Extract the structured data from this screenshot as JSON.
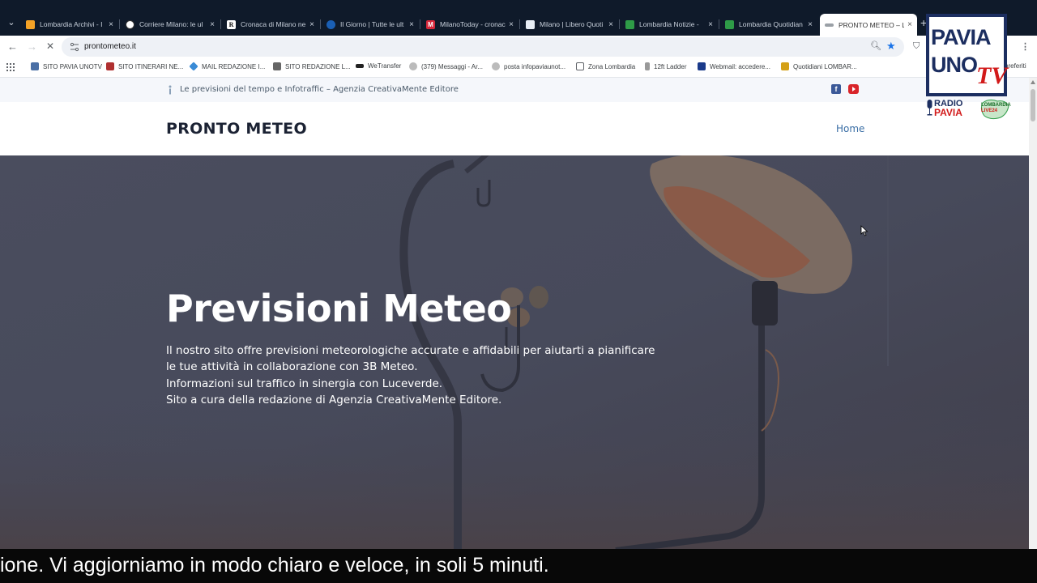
{
  "browser": {
    "tabs": [
      {
        "title": "Lombardia Archivi - I",
        "fav_color": "#f4a226"
      },
      {
        "title": "Corriere Milano: le ul",
        "fav_color": "#333333"
      },
      {
        "title": "Cronaca di Milano ne",
        "fav_color": "#222222"
      },
      {
        "title": "Il Giorno | Tutte le ult",
        "fav_color": "#1a5fb4"
      },
      {
        "title": "MilanoToday - cronac",
        "fav_color": "#d6283b"
      },
      {
        "title": "Milano | Libero Quoti",
        "fav_color": "#e8eef5"
      },
      {
        "title": "Lombardia Notizie - ",
        "fav_color": "#2e9b47"
      },
      {
        "title": "Lombardia Quotidian",
        "fav_color": "#2e9b47"
      },
      {
        "title": "PRONTO METEO – Le",
        "fav_color": "#9aa0a6"
      }
    ],
    "tab_close": "×",
    "new_tab": "+",
    "url": "prontometeo.it",
    "bookmarks": [
      {
        "label": "SITO PAVIA UNOTV",
        "color": "#4a6fa5"
      },
      {
        "label": "SITO ITINERARI NE...",
        "color": "#b03030"
      },
      {
        "label": "MAIL REDAZIONE I...",
        "color": "#3a8bd6"
      },
      {
        "label": "SITO REDAZIONE L...",
        "color": "#666666"
      },
      {
        "label": "WeTransfer",
        "color": "#222222"
      },
      {
        "label": "(379) Messaggi - Ar...",
        "color": "#888888"
      },
      {
        "label": "posta infopaviaunot...",
        "color": "#888888"
      },
      {
        "label": "Zona Lombardia",
        "color": "#5f6368"
      },
      {
        "label": "12ft Ladder",
        "color": "#888888"
      },
      {
        "label": "Webmail: accedere...",
        "color": "#1a3a8a"
      },
      {
        "label": "Quotidiani LOMBAR...",
        "color": "#d4a017"
      }
    ],
    "bookmarks_right": "preferiti"
  },
  "site": {
    "topbar_text": "Le previsioni del tempo e Infotraffic – Agenzia CreativaMente Editore",
    "facebook_glyph": "f",
    "title": "PRONTO METEO",
    "nav_home": "Home",
    "hero_title": "Previsioni Meteo",
    "hero_lines": [
      "Il nostro sito offre previsioni meteorologiche accurate e affidabili per aiutarti a pianificare",
      "le tue attività in collaborazione con 3B Meteo.",
      "Informazioni sul traffico in sinergia con Luceverde.",
      "Sito a cura della redazione di Agenzia CreativaMente Editore."
    ]
  },
  "overlay": {
    "logo_line1": "PAVIA",
    "logo_line2": "UNO",
    "logo_tv": "TV",
    "radio_line1": "RADIO",
    "radio_line2": "PAVIA",
    "lombardia_line1": "LOMBARDIA",
    "lombardia_line2": "LIVE24",
    "caption": "ione. Vi aggiorniamo in modo chiaro e veloce, in soli 5 minuti."
  },
  "colors": {
    "accent_blue": "#3a6ea5",
    "brand_navy": "#1c2e60",
    "brand_red": "#d21a1a"
  }
}
